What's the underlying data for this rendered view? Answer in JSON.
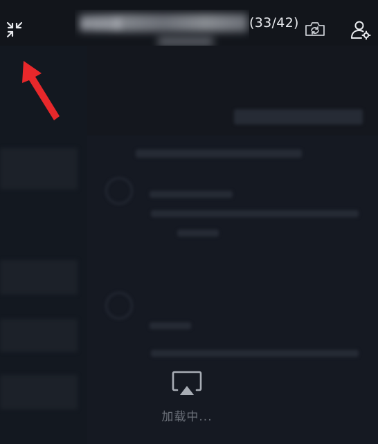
{
  "header": {
    "title": "课程标题",
    "page_counter": "(33/42)"
  },
  "icons": {
    "exit_fullscreen": "exit-fullscreen-icon",
    "camera": "camera-switch-icon",
    "user_settings": "user-settings-icon",
    "screen_cast": "screen-cast-icon",
    "annotation_arrow": "red-arrow-annotation"
  },
  "main": {
    "loading_text": "加载中..."
  },
  "colors": {
    "background": "#14171e",
    "annotation_arrow": "#e8282b"
  }
}
